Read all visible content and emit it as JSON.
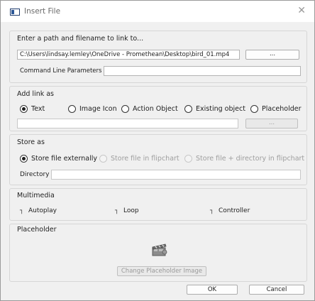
{
  "window": {
    "title": "Insert File",
    "close_icon": "✕"
  },
  "path_section": {
    "title": "Enter a path and filename to link to...",
    "path_value": "C:\\Users\\lindsay.lemley\\OneDrive - Promethean\\Desktop\\bird_01.mp4",
    "browse_label": "...",
    "cmd_label": "Command Line Parameters",
    "cmd_value": ""
  },
  "link_section": {
    "title": "Add link as",
    "options": [
      {
        "label": "Text",
        "selected": true
      },
      {
        "label": "Image Icon",
        "selected": false
      },
      {
        "label": "Action Object",
        "selected": false
      },
      {
        "label": "Existing object",
        "selected": false
      },
      {
        "label": "Placeholder",
        "selected": false
      }
    ],
    "text_value": "",
    "browse_label": "..."
  },
  "store_section": {
    "title": "Store as",
    "options": [
      {
        "label": "Store file externally",
        "selected": true,
        "enabled": true
      },
      {
        "label": "Store file in flipchart",
        "selected": false,
        "enabled": false
      },
      {
        "label": "Store file + directory in flipchart",
        "selected": false,
        "enabled": false
      }
    ],
    "directory_label": "Directory",
    "directory_value": ""
  },
  "multimedia_section": {
    "title": "Multimedia",
    "options": [
      {
        "label": "Autoplay",
        "checked": false
      },
      {
        "label": "Loop",
        "checked": false
      },
      {
        "label": "Controller",
        "checked": false
      }
    ]
  },
  "placeholder_section": {
    "title": "Placeholder",
    "change_button": "Change Placeholder Image",
    "icon": "clapperboard-icon"
  },
  "footer": {
    "ok_label": "OK",
    "cancel_label": "Cancel"
  }
}
